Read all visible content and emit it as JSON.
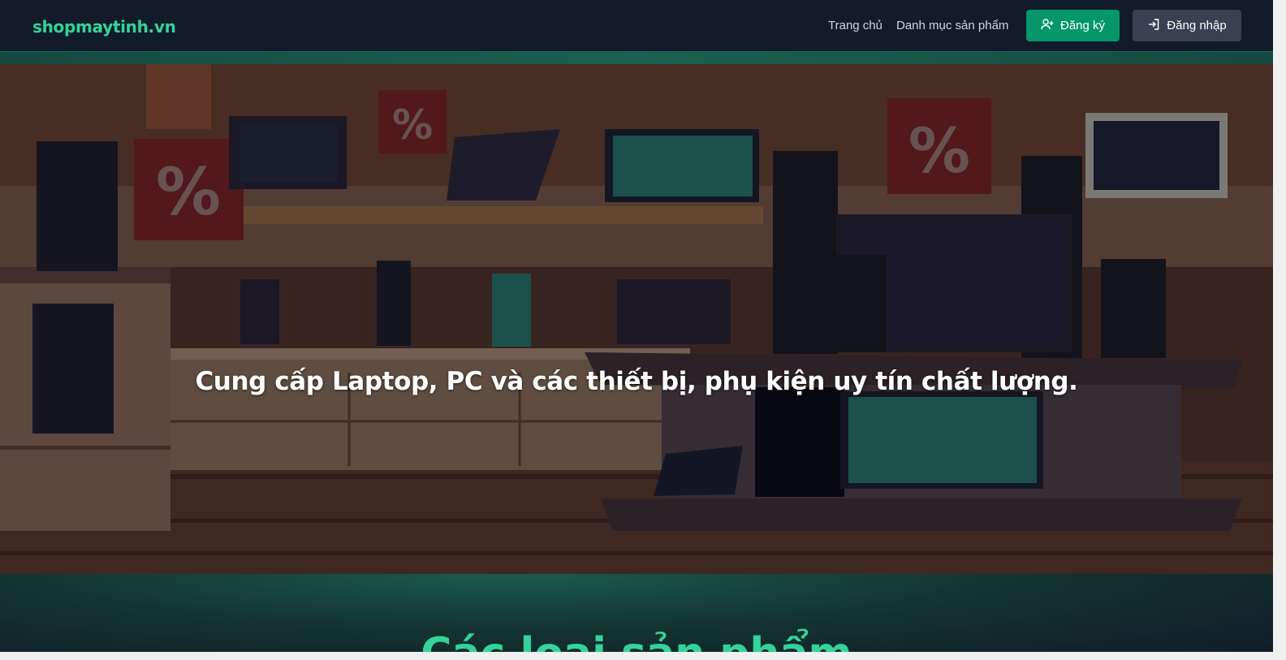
{
  "header": {
    "brand": "shopmaytinh.vn",
    "nav": [
      "Trang chủ",
      "Danh mục sản phẩm"
    ],
    "register_label": "Đăng ký",
    "login_label": "Đăng nhập"
  },
  "hero": {
    "title": "Cung cấp Laptop, PC và các thiết bị, phụ kiện uy tín chất lượng."
  },
  "section": {
    "title": "Các loại sản phẩm"
  },
  "colors": {
    "accent": "#34d399",
    "register_bg": "#059669",
    "login_bg": "#374151",
    "navbar_bg": "#111b29"
  }
}
